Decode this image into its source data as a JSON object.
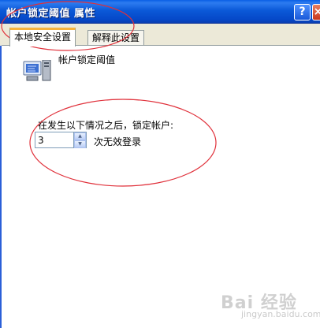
{
  "window": {
    "title": "帐户锁定阈值 属性",
    "help_symbol": "?",
    "close_symbol": "×"
  },
  "tabs": [
    {
      "label": "本地安全设置",
      "active": true
    },
    {
      "label": "解释此设置",
      "active": false
    }
  ],
  "policy": {
    "icon": "policy-computer-icon",
    "name": "帐户锁定阈值"
  },
  "setting": {
    "prompt": "在发生以下情况之后，锁定帐户:",
    "value": "3",
    "unit_label": "次无效登录"
  },
  "watermark": {
    "text": "Bai 经验",
    "sub": "jingyan.baidu.com"
  },
  "colors": {
    "annotation": "#e0303a",
    "titlebar": "#0b59d8",
    "tab_highlight": "#f7b33b"
  }
}
